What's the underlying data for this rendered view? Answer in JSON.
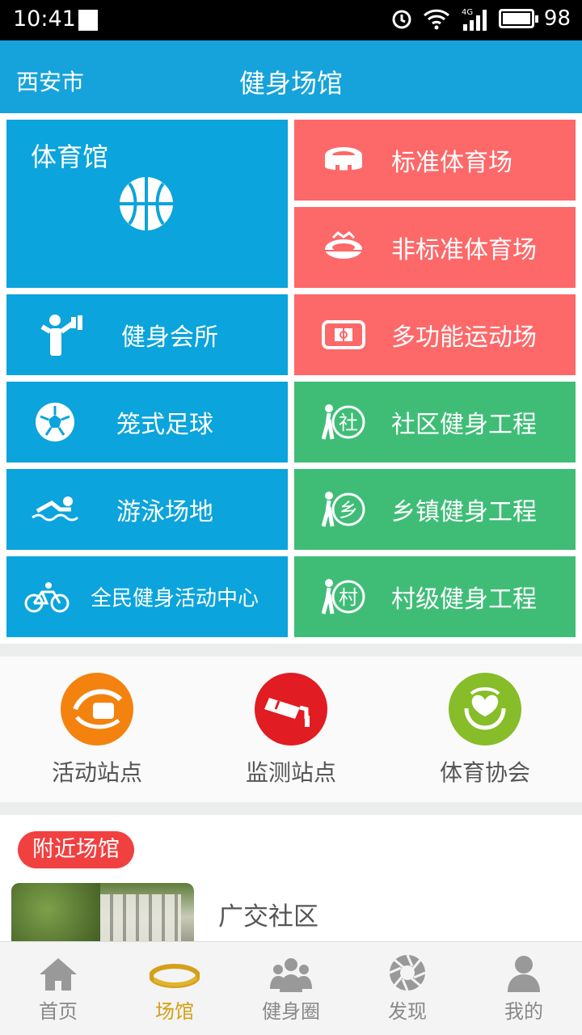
{
  "status": {
    "time": "10:41",
    "network": "4G",
    "battery": "98"
  },
  "header": {
    "city": "西安市",
    "title": "健身场馆"
  },
  "tiles": {
    "gym": "体育馆",
    "standard_stadium": "标准体育场",
    "nonstandard_stadium": "非标准体育场",
    "fitness_club": "健身会所",
    "multi_field": "多功能运动场",
    "cage_football": "笼式足球",
    "community_fitness": "社区健身工程",
    "swimming": "游泳场地",
    "town_fitness": "乡镇健身工程",
    "public_fitness_center": "全民健身活动中心",
    "village_fitness": "村级健身工程",
    "icon_text_she": "社",
    "icon_text_xiang": "乡",
    "icon_text_cun": "村"
  },
  "sites": [
    {
      "label": "活动站点",
      "color": "#f4820f"
    },
    {
      "label": "监测站点",
      "color": "#e11c22"
    },
    {
      "label": "体育协会",
      "color": "#86bd29"
    }
  ],
  "nearby": {
    "badge": "附近场馆",
    "first_name": "广交社区"
  },
  "tabs": [
    {
      "label": "首页"
    },
    {
      "label": "场馆"
    },
    {
      "label": "健身圈"
    },
    {
      "label": "发现"
    },
    {
      "label": "我的"
    }
  ],
  "colors": {
    "header": "#16a3db",
    "blue_tile": "#0ba4dc",
    "red_tile": "#fd6869",
    "green_tile": "#3fbd77",
    "active_tab": "#d4a018"
  }
}
